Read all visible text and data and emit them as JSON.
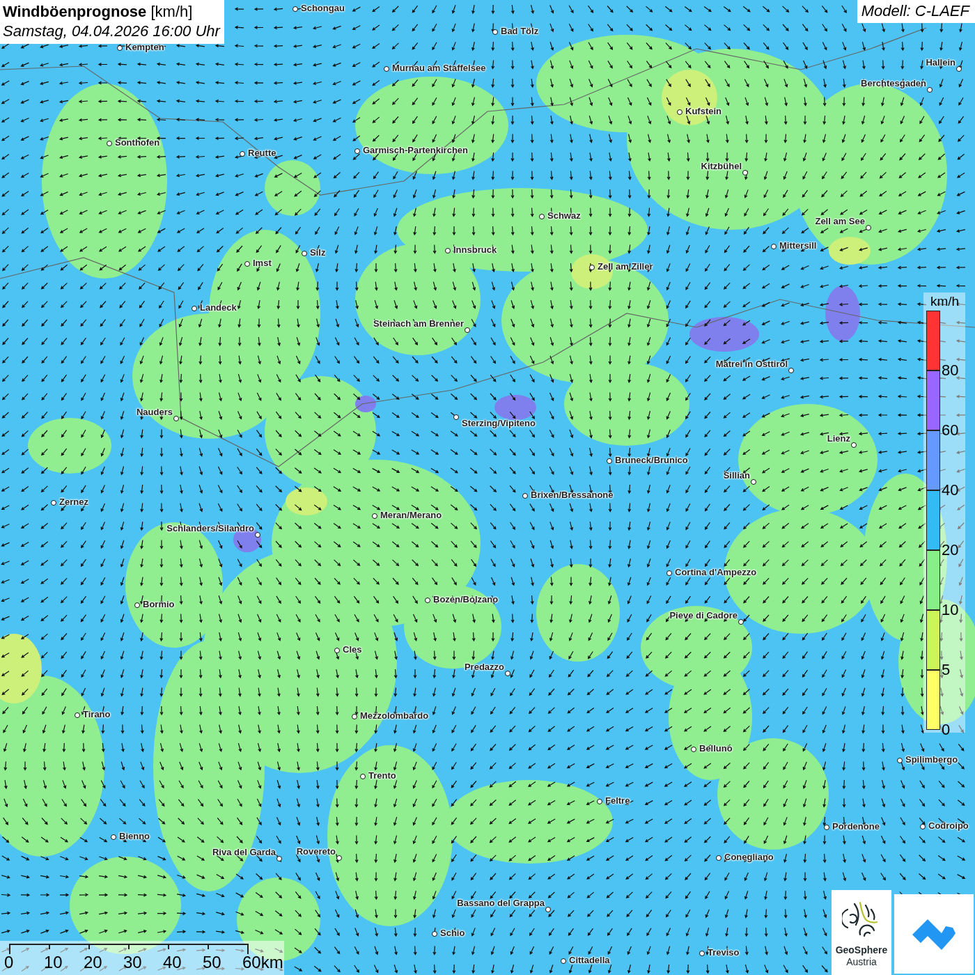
{
  "title": "**Windböenprognose** [km/h]",
  "subtitle": "Samstag, 04.04.2026 16:00 Uhr",
  "model": "Modell: C-LAEF",
  "cities": [
    {
      "name": "Schongau"
    },
    {
      "name": "Bad Tölz"
    },
    {
      "name": "Kempten"
    },
    {
      "name": "Hallein"
    },
    {
      "name": "Murnau am Staffelsee"
    },
    {
      "name": "Berchtesgaden"
    },
    {
      "name": "Kufstein"
    },
    {
      "name": "Sonthofen"
    },
    {
      "name": "Reutte"
    },
    {
      "name": "Garmisch-Partenkirchen"
    },
    {
      "name": "Kitzbühel"
    },
    {
      "name": "Schwaz"
    },
    {
      "name": "Zell am See"
    },
    {
      "name": "Mittersill"
    },
    {
      "name": "Innsbruck"
    },
    {
      "name": "Silz"
    },
    {
      "name": "Imst"
    },
    {
      "name": "Zell am Ziller"
    },
    {
      "name": "Landeck"
    },
    {
      "name": "Steinach am Brenner"
    },
    {
      "name": "Matrei in Osttirol"
    },
    {
      "name": "Nauders"
    },
    {
      "name": "Sterzing/Vipiteno"
    },
    {
      "name": "Lienz"
    },
    {
      "name": "Bruneck/Brunico"
    },
    {
      "name": "Sillian"
    },
    {
      "name": "Brixen/Bressanone"
    },
    {
      "name": "Zernez"
    },
    {
      "name": "Meran/Merano"
    },
    {
      "name": "Schlanders/Silandro"
    },
    {
      "name": "Cortina d'Ampezzo"
    },
    {
      "name": "Bormio"
    },
    {
      "name": "Bozen/Bolzano"
    },
    {
      "name": "Pieve di Cadore"
    },
    {
      "name": "Cles"
    },
    {
      "name": "Predazzo"
    },
    {
      "name": "Tirano"
    },
    {
      "name": "Mezzolombardo"
    },
    {
      "name": "Belluno"
    },
    {
      "name": "Spilimbergo"
    },
    {
      "name": "Trento"
    },
    {
      "name": "Feltre"
    },
    {
      "name": "Pordenone"
    },
    {
      "name": "Codroipo"
    },
    {
      "name": "Bienno"
    },
    {
      "name": "Riva del Garda"
    },
    {
      "name": "Rovereto"
    },
    {
      "name": "Conegliano"
    },
    {
      "name": "Bassano del Grappa"
    },
    {
      "name": "Schio"
    },
    {
      "name": "Treviso"
    },
    {
      "name": "Cittadella"
    }
  ],
  "legend": {
    "unit": "km/h",
    "bins": [
      {
        "color": "#ff3333",
        "label": "80"
      },
      {
        "color": "#9966ff",
        "label": "60"
      },
      {
        "color": "#6699ff",
        "label": "40"
      },
      {
        "color": "#33bbf5",
        "label": "20"
      },
      {
        "color": "#88ee88",
        "label": "10"
      },
      {
        "color": "#ccf55a",
        "label": "5"
      },
      {
        "color": "#ffff66",
        "label": "0"
      }
    ]
  },
  "scale": {
    "ticks": [
      "0",
      "10",
      "20",
      "30",
      "40",
      "50",
      "60km"
    ]
  },
  "logos": {
    "org_name": "GeoSphere",
    "org_country": "Austria"
  }
}
